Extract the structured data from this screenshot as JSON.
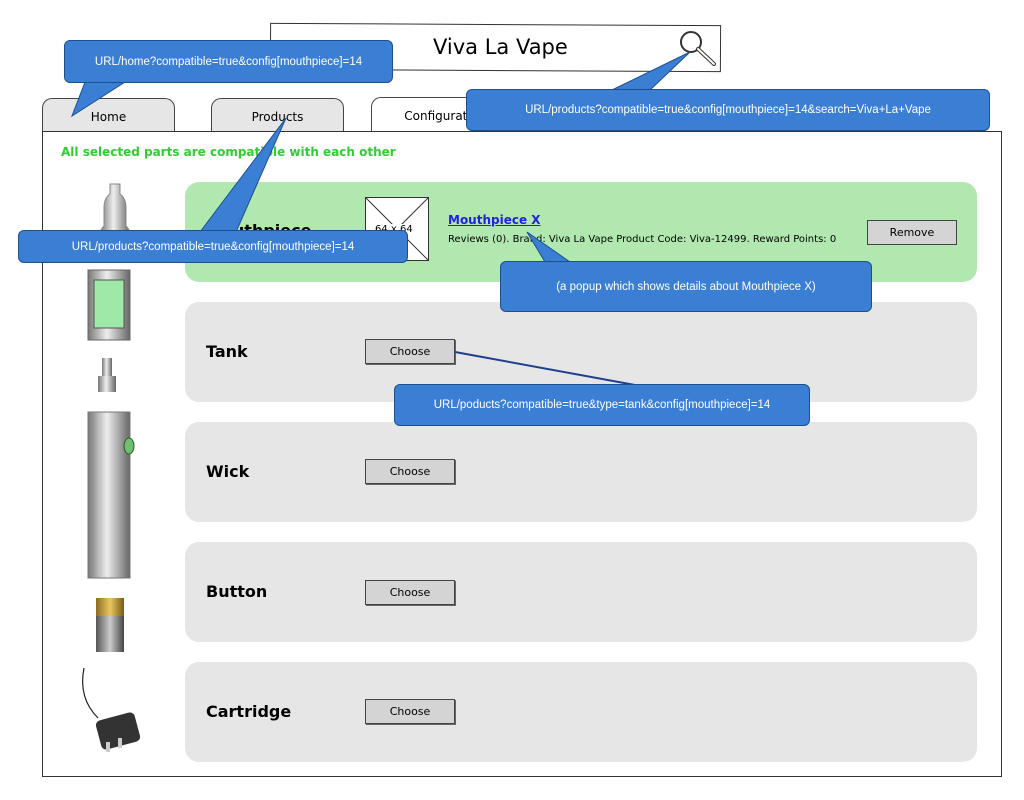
{
  "header": {
    "site_title": "Viva La Vape",
    "search_icon": "magnifier-icon"
  },
  "tabs": [
    {
      "label": "Home",
      "active": false
    },
    {
      "label": "Products",
      "active": false
    },
    {
      "label": "Configurati",
      "active": true
    }
  ],
  "compat_message": "All selected parts are compatible with each other",
  "rows": [
    {
      "label": "Mouthpiece",
      "selected": true,
      "thumb_text": "64 x 64",
      "product_name": "Mouthpiece X",
      "product_meta": "Reviews (0). Brand: Viva La Vape Product Code: Viva-12499. Reward Points: 0",
      "button": "Remove"
    },
    {
      "label": "Tank",
      "button": "Choose"
    },
    {
      "label": "Wick",
      "button": "Choose"
    },
    {
      "label": "Button",
      "button": "Choose"
    },
    {
      "label": "Cartridge",
      "button": "Choose"
    }
  ],
  "callouts": {
    "home": "URL/home?compatible=true&config[mouthpiece]=14",
    "search": "URL/products?compatible=true&config[mouthpiece]=14&search=Viva+La+Vape",
    "products": "URL/products?compatible=true&config[mouthpiece]=14",
    "popup": "(a popup which shows details about Mouthpiece X)",
    "tank": "URL/poducts?compatible=true&type=tank&config[mouthpiece]=14"
  },
  "colors": {
    "callout_fill": "#3b7fd4",
    "selected_row": "#b0e8b0",
    "row": "#e6e6e6",
    "compat_text": "#33cc33",
    "link": "#2222dd"
  }
}
